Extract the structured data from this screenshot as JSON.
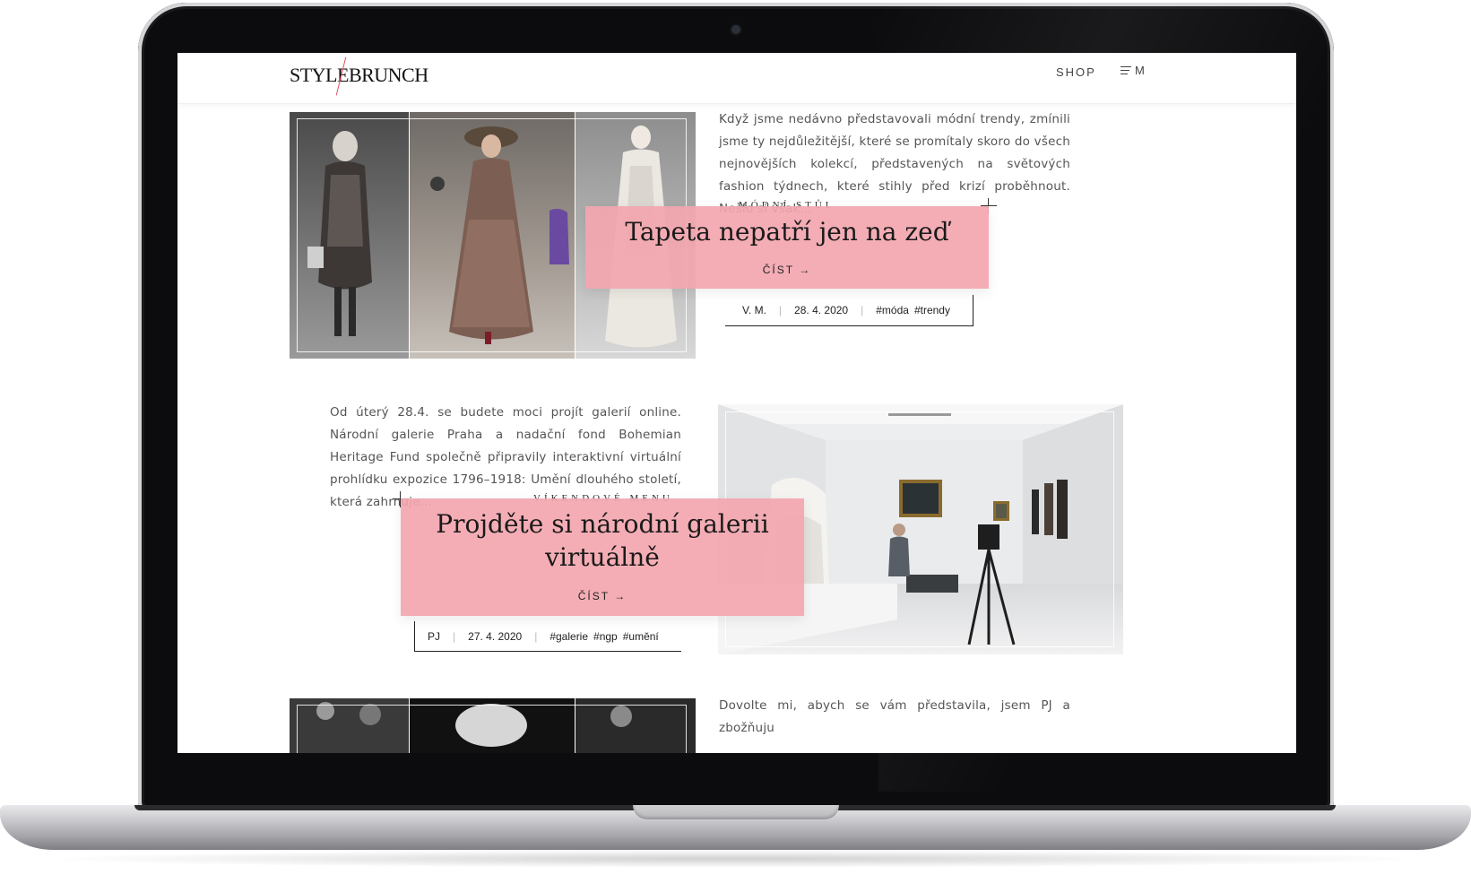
{
  "header": {
    "logo": "STYLEBRUNCH",
    "nav_shop": "SHOP",
    "nav_menu": "M"
  },
  "articles": [
    {
      "excerpt": "Když jsme nedávno představovali módní trendy, zmínili jsme ty nejdůležitější, které se promítaly skoro do všech nejnovějších kolekcí, představených na světových fashion týdnech, které stihly před krizí proběhnout. Nešlo si však…",
      "category": "MÓDNÍ STŮL",
      "title": "Tapeta nepatří jen na zeď",
      "read_label": "ČÍST →",
      "author": "V. M.",
      "date": "28. 4. 2020",
      "tags": [
        "#móda",
        "#trendy"
      ]
    },
    {
      "excerpt": "Od úterý 28.4. se budete moci projít galerií online. Národní galerie Praha a nadační fond Bohemian Heritage Fund společně připravily interaktivní virtuální prohlídku expozice 1796–1918: Umění dlouhého století, která zahrnuje…",
      "category": "VÍKENDOVÉ MENU",
      "title": "Projděte si národní galerii virtuálně",
      "read_label": "ČÍST →",
      "author": "PJ",
      "date": "27. 4. 2020",
      "tags": [
        "#galerie",
        "#ngp",
        "#umění"
      ]
    },
    {
      "excerpt": "Dovolte mi, abych se vám představila, jsem PJ a zbožňuju"
    }
  ],
  "colors": {
    "card_pink": "#f3a6af",
    "logo_accent": "#e0525e"
  }
}
